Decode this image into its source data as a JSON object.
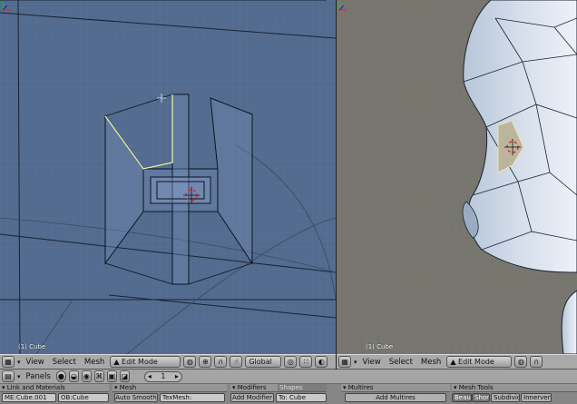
{
  "viewports": {
    "left": {
      "object_label": "(1) Cube"
    },
    "right": {
      "object_label": "(1) Cube"
    }
  },
  "header": {
    "menus": [
      "View",
      "Select",
      "Mesh"
    ],
    "mode": "Edit Mode",
    "orientation": "Global"
  },
  "buttons_header": {
    "panels_label": "Panels",
    "frame_value": "1"
  },
  "panels": {
    "link_materials": {
      "title": "Link and Materials",
      "mesh_field": "ME:Cube.001",
      "object_field": "OB:Cube"
    },
    "mesh": {
      "title": "Mesh",
      "auto_smooth": "Auto Smooth",
      "texmesh": "TexMesh:"
    },
    "modifiers": {
      "title": "Modifiers",
      "shapes_tab": "Shapes",
      "add_modifier": "Add Modifier",
      "to": "To: Cube"
    },
    "multires": {
      "title": "Multires",
      "add": "Add Multires"
    },
    "mesh_tools": {
      "title": "Mesh Tools",
      "beaut": "Beaut",
      "short": "Short",
      "subdivide": "Subdivide",
      "innervert": "Innervert"
    }
  },
  "colors": {
    "left_viewport_bg": "#536b8f",
    "right_viewport_bg": "#77776f",
    "selected_edge": "#f0f0a0",
    "header_bg": "#a9a9a9"
  },
  "icons": [
    "editor-type-icon",
    "mode-icon",
    "pivot-icon",
    "magnet-icon",
    "hand-icon",
    "proportional-icon",
    "render-icon",
    "axis-gizmo-icon",
    "3d-cursor-icon"
  ]
}
